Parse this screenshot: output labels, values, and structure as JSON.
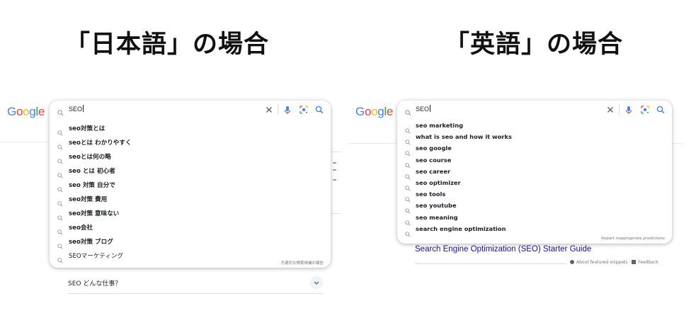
{
  "headings": {
    "left": "「日本語」の場合",
    "right": "「英語」の場合"
  },
  "logo": {
    "letters": [
      "G",
      "o",
      "o",
      "g",
      "l",
      "e"
    ],
    "colors": [
      "#4285F4",
      "#EA4335",
      "#FBBC05",
      "#4285F4",
      "#34A853",
      "#EA4335"
    ]
  },
  "left_panel": {
    "query": "SEO",
    "suggestions": [
      "seo対策とは",
      "seoとは わかりやすく",
      "seoとは何の略",
      "seo とは 初心者",
      "seo 対策 自分で",
      "seo対策 費用",
      "seo対策 意味ない",
      "seo会社",
      "seo対策 ブログ",
      "SEOマーケティング"
    ],
    "report_text": "不適切な検索候補の報告",
    "people_also_ask": "SEO どんな仕事？"
  },
  "right_panel": {
    "query": "SEO",
    "suggestions": [
      "seo marketing",
      "what is seo and how it works",
      "seo google",
      "seo course",
      "seo career",
      "seo optimizer",
      "seo tools",
      "seo youtube",
      "seo meaning",
      "search engine optimization"
    ],
    "report_text": "Report inappropriate predictions",
    "result_link": "Search Engine Optimization (SEO) Starter Guide",
    "featured_snippets": "About featured snippets",
    "feedback": "Feedback"
  },
  "icons": {
    "search": "search-icon",
    "clear": "close-icon",
    "voice": "microphone-icon",
    "lens": "lens-icon",
    "chevron": "chevron-down-icon"
  },
  "colors": {
    "link": "#1a0dab",
    "mic_blue": "#4285F4",
    "mic_red": "#EA4335",
    "mic_yellow": "#FBBC05",
    "mic_green": "#34A853"
  }
}
